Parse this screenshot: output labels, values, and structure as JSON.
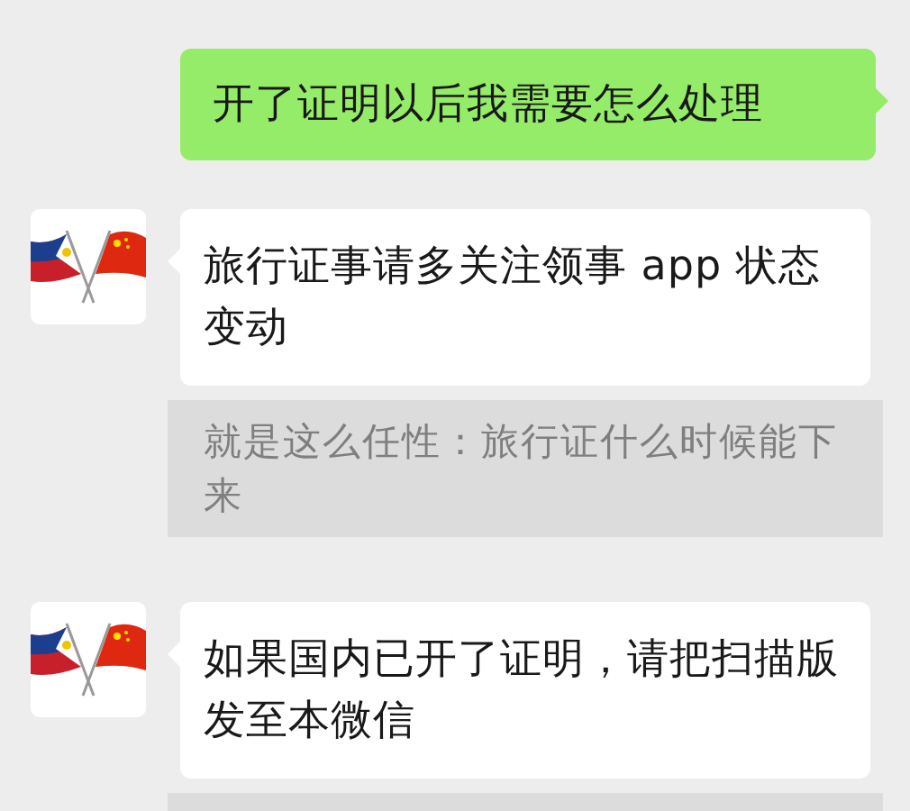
{
  "messages": [
    {
      "kind": "sent",
      "text": "开了证明以后我需要怎么处理"
    },
    {
      "kind": "received",
      "text": "旅行证事请多关注领事 app 状态变动",
      "quote": {
        "kind": "full",
        "text": "就是这么任性：旅行证什么时候能下来"
      }
    },
    {
      "kind": "received",
      "text": "如果国内已开了证明，请把扫描版发至本微信",
      "quote": {
        "kind": "cut"
      }
    }
  ]
}
